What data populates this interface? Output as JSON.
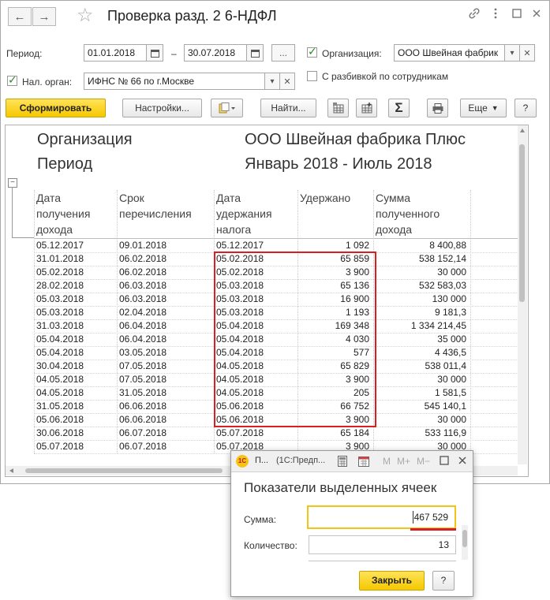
{
  "window": {
    "title": "Проверка разд. 2 6-НДФЛ",
    "back_glyph": "←",
    "forward_glyph": "→",
    "star_glyph": "☆",
    "icons": [
      "link-icon",
      "more-icon",
      "maximize-icon",
      "close-icon"
    ]
  },
  "filters": {
    "period_label": "Период:",
    "period_from": "01.01.2018",
    "period_dash": "–",
    "period_to": "30.07.2018",
    "period_more": "...",
    "org_checked": true,
    "org_label": "Организация:",
    "org_value": "ООО Швейная фабрик",
    "tax_checked": true,
    "tax_label": "Нал. орган:",
    "tax_value": "ИФНС № 66 по г.Москве",
    "split_checked": false,
    "split_label": "С разбивкой по сотрудникам"
  },
  "toolbar": {
    "generate": "Сформировать",
    "settings": "Настройки...",
    "find": "Найти...",
    "sigma": "Σ",
    "more": "Еще",
    "help": "?"
  },
  "report": {
    "org_label": "Организация",
    "org_value": "ООО Швейная фабрика Плюс",
    "period_label": "Период",
    "period_value": "Январь 2018 - Июль 2018",
    "columns": [
      [
        "Дата",
        "получения",
        "дохода"
      ],
      [
        "Срок",
        "перечисления"
      ],
      [
        "Дата",
        "удержания",
        "налога"
      ],
      [
        "Удержано"
      ],
      [
        "Сумма",
        "полученного",
        "дохода"
      ]
    ],
    "rows": [
      [
        "05.12.2017",
        "09.01.2018",
        "05.12.2017",
        "1 092",
        "8 400,88"
      ],
      [
        "31.01.2018",
        "06.02.2018",
        "05.02.2018",
        "65 859",
        "538 152,14"
      ],
      [
        "05.02.2018",
        "06.02.2018",
        "05.02.2018",
        "3 900",
        "30 000"
      ],
      [
        "28.02.2018",
        "06.03.2018",
        "05.03.2018",
        "65 136",
        "532 583,03"
      ],
      [
        "05.03.2018",
        "06.03.2018",
        "05.03.2018",
        "16 900",
        "130 000"
      ],
      [
        "05.03.2018",
        "02.04.2018",
        "05.03.2018",
        "1 193",
        "9 181,3"
      ],
      [
        "31.03.2018",
        "06.04.2018",
        "05.04.2018",
        "169 348",
        "1 334 214,45"
      ],
      [
        "05.04.2018",
        "06.04.2018",
        "05.04.2018",
        "4 030",
        "35 000"
      ],
      [
        "05.04.2018",
        "03.05.2018",
        "05.04.2018",
        "577",
        "4 436,5"
      ],
      [
        "30.04.2018",
        "07.05.2018",
        "04.05.2018",
        "65 829",
        "538 011,4"
      ],
      [
        "04.05.2018",
        "07.05.2018",
        "04.05.2018",
        "3 900",
        "30 000"
      ],
      [
        "04.05.2018",
        "31.05.2018",
        "04.05.2018",
        "205",
        "1 581,5"
      ],
      [
        "31.05.2018",
        "06.06.2018",
        "05.06.2018",
        "66 752",
        "545 140,1"
      ],
      [
        "05.06.2018",
        "06.06.2018",
        "05.06.2018",
        "3 900",
        "30 000"
      ],
      [
        "30.06.2018",
        "06.07.2018",
        "05.07.2018",
        "65 184",
        "533 116,9"
      ],
      [
        "05.07.2018",
        "06.07.2018",
        "05.07.2018",
        "3 900",
        "30 000"
      ]
    ],
    "collapse_glyph": "−",
    "highlight_color": "#d92020"
  },
  "popup": {
    "title": "П...",
    "title_app": "(1С:Предп...",
    "m_label": "M",
    "mplus_label": "M+",
    "mminus_label": "M−",
    "heading": "Показатели выделенных ячеек",
    "sum_label": "Сумма:",
    "sum_value": "467 529",
    "count_label": "Количество:",
    "count_value": "13",
    "close_button": "Закрыть",
    "help_button": "?"
  }
}
